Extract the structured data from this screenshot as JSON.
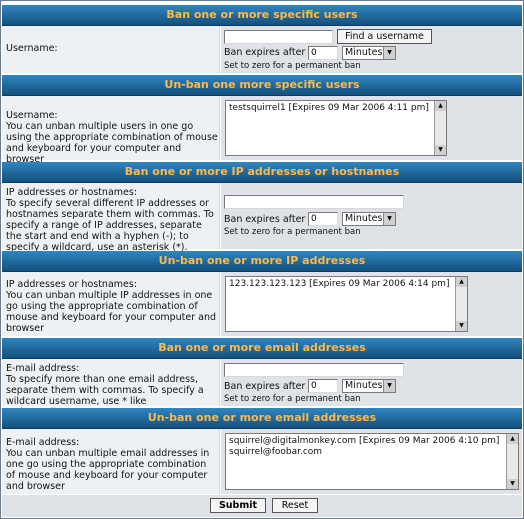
{
  "ban_users": {
    "header": "Ban one or more specific users",
    "label": "Username:",
    "username_value": "",
    "find_button": "Find a username",
    "expires_label": "Ban expires after",
    "expires_value": "0",
    "unit": "Minutes",
    "hint": "Set to zero for a permanent ban"
  },
  "unban_users": {
    "header": "Un-ban one more specific users",
    "label": "Username:",
    "desc": "You can unban multiple users in one go using the appropriate combination of mouse and keyboard for your computer and browser",
    "items": [
      "testsquirrel1 [Expires 09 Mar 2006 4:11 pm]"
    ]
  },
  "ban_ips": {
    "header": "Ban one or more IP addresses or hostnames",
    "label": "IP addresses or hostnames:",
    "desc": "To specify several different IP addresses or hostnames separate them with commas. To specify a range of IP addresses, separate the start and end with a hyphen (-); to specify a wildcard, use an asterisk (*).",
    "ip_value": "",
    "expires_label": "Ban expires after",
    "expires_value": "0",
    "unit": "Minutes",
    "hint": "Set to zero for a permanent ban"
  },
  "unban_ips": {
    "header": "Un-ban one or more IP addresses",
    "label": "IP addresses or hostnames:",
    "desc": "You can unban multiple IP addresses in one go using the appropriate combination of mouse and keyboard for your computer and browser",
    "items": [
      "123.123.123.123 [Expires 09 Mar 2006 4:14 pm]"
    ]
  },
  "ban_emails": {
    "header": "Ban one or more email addresses",
    "label": "E-mail address:",
    "desc": "To specify more than one email address, separate them with commas. To specify a wildcard username, use * like *@hotmail.com",
    "email_value": "",
    "expires_label": "Ban expires after",
    "expires_value": "0",
    "unit": "Minutes",
    "hint": "Set to zero for a permanent ban"
  },
  "unban_emails": {
    "header": "Un-ban one or more email addresses",
    "label": "E-mail address:",
    "desc": "You can unban multiple email addresses in one go using the appropriate combination of mouse and keyboard for your computer and browser",
    "items": [
      "squirrel@digitalmonkey.com [Expires 09 Mar 2006 4:10 pm]",
      "squirrel@foobar.com"
    ]
  },
  "footer": {
    "submit": "Submit",
    "reset": "Reset"
  },
  "colors": {
    "header_bg": "#1f6a9e",
    "header_text": "#ffb84a",
    "left_bg": "#eef1f4",
    "right_bg": "#dfe3e8"
  }
}
